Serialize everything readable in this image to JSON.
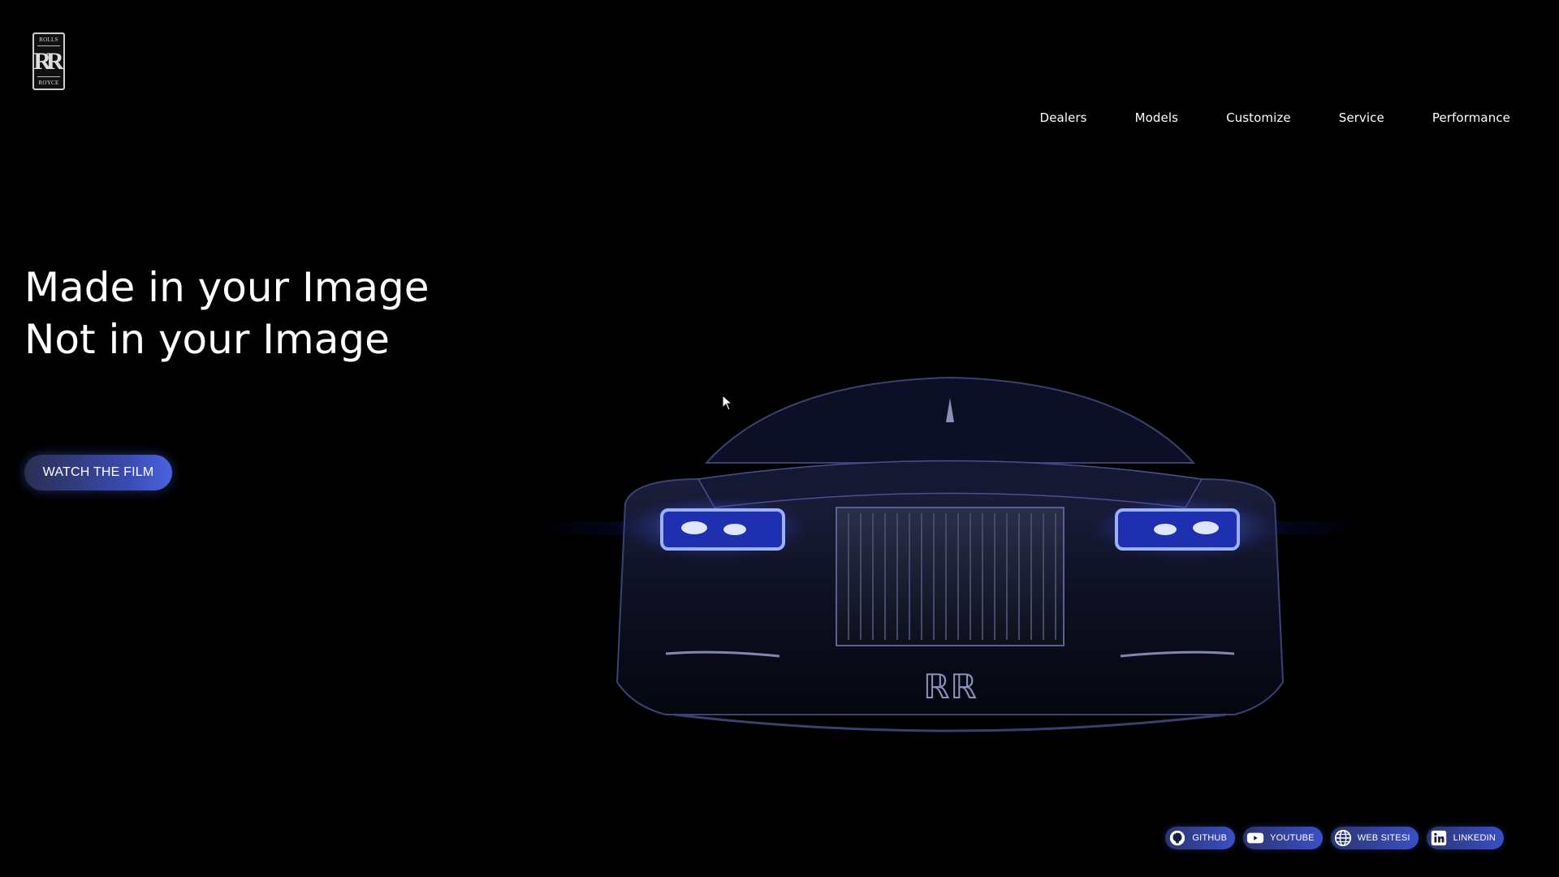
{
  "brand": {
    "logo_top": "ROLLS",
    "logo_mark": "RR",
    "logo_bottom": "ROYCE"
  },
  "nav": [
    {
      "label": "Dealers"
    },
    {
      "label": "Models"
    },
    {
      "label": "Customize"
    },
    {
      "label": "Service"
    },
    {
      "label": "Performance"
    }
  ],
  "hero": {
    "line1": "Made in your Image",
    "line2": "Not in your Image",
    "cta": "WATCH THE FILM"
  },
  "social": [
    {
      "label": "GITHUB",
      "icon": "github-icon"
    },
    {
      "label": "YOUTUBE",
      "icon": "youtube-icon"
    },
    {
      "label": "WEB SITESI",
      "icon": "globe-icon"
    },
    {
      "label": "LINKEDIN",
      "icon": "linkedin-icon"
    }
  ],
  "colors": {
    "accent": "#3b4fc4",
    "background": "#000000",
    "headlight": "#4a6bff"
  }
}
